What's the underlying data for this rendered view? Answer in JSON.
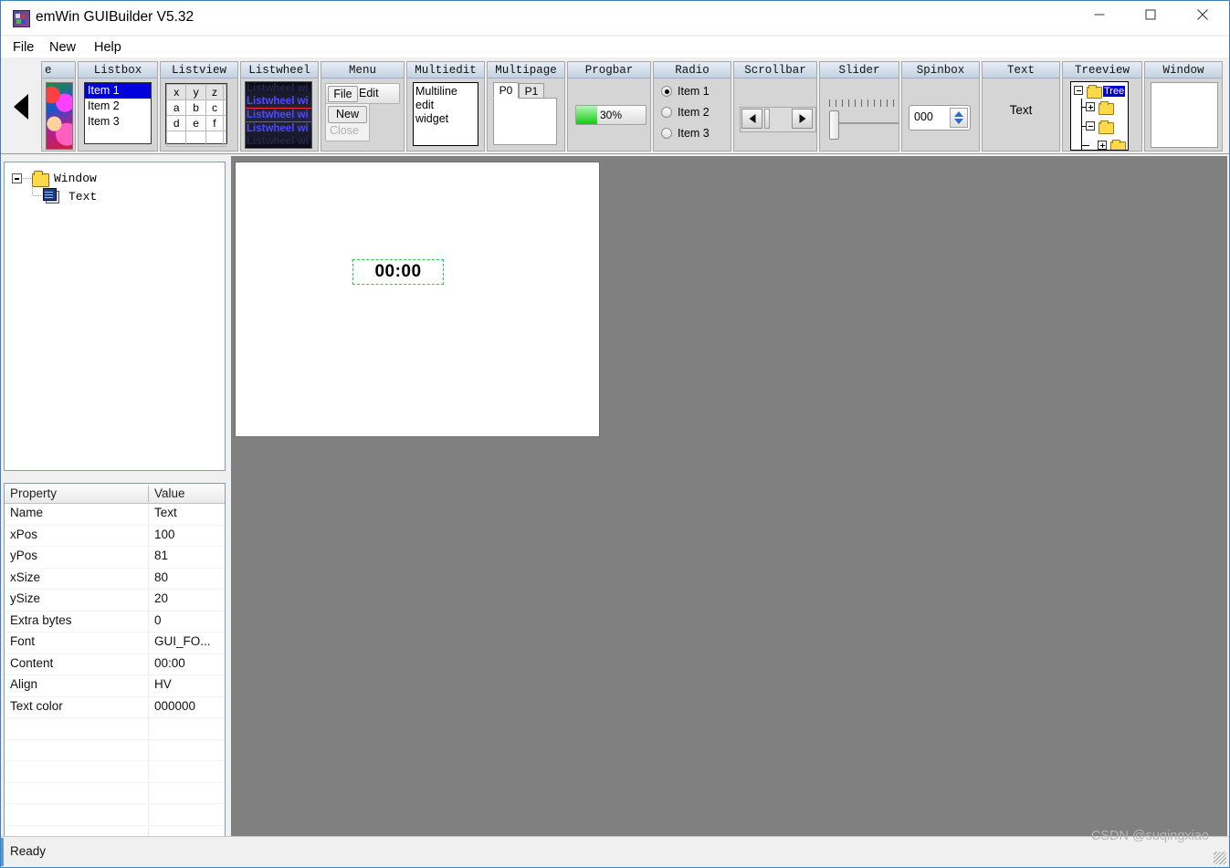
{
  "window": {
    "title": "emWin GUIBuilder V5.32",
    "controls": {
      "minimize": "minimize-button",
      "maximize": "maximize-button",
      "close": "close-button"
    }
  },
  "menubar": {
    "items": [
      "File",
      "New",
      "Help"
    ]
  },
  "toolbar": {
    "scroll_left": "◀",
    "panels": [
      {
        "title": "e",
        "type": "image"
      },
      {
        "title": "Listbox",
        "type": "listbox",
        "items": [
          "Item 1",
          "Item 2",
          "Item 3"
        ],
        "selected_index": 0
      },
      {
        "title": "Listview",
        "type": "listview",
        "header": [
          "x",
          "y",
          "z"
        ],
        "rows": [
          [
            "a",
            "b",
            "c"
          ],
          [
            "d",
            "e",
            "f"
          ]
        ]
      },
      {
        "title": "Listwheel",
        "type": "listwheel",
        "item_text": "Listwheel wi"
      },
      {
        "title": "Menu",
        "type": "menu",
        "bar": [
          "File",
          "Edit"
        ],
        "dropdown": [
          "New",
          "Close"
        ],
        "disabled": [
          "Close"
        ]
      },
      {
        "title": "Multiedit",
        "type": "multiedit",
        "lines": [
          "Multiline",
          "edit",
          "widget"
        ]
      },
      {
        "title": "Multipage",
        "type": "multipage",
        "tabs": [
          "P0",
          "P1"
        ],
        "active_index": 0
      },
      {
        "title": "Progbar",
        "type": "progbar",
        "value": 30,
        "value_label": "30%"
      },
      {
        "title": "Radio",
        "type": "radio",
        "items": [
          "Item 1",
          "Item 2",
          "Item 3"
        ],
        "selected_index": 0
      },
      {
        "title": "Scrollbar",
        "type": "scrollbar"
      },
      {
        "title": "Slider",
        "type": "slider"
      },
      {
        "title": "Spinbox",
        "type": "spinbox",
        "value": "000"
      },
      {
        "title": "Text",
        "type": "text",
        "content": "Text"
      },
      {
        "title": "Treeview",
        "type": "treeview",
        "selected_label": "Tree"
      },
      {
        "title": "Window",
        "type": "window"
      }
    ]
  },
  "object_tree": {
    "root": {
      "label": "Window",
      "expanded": true
    },
    "child": {
      "label": "Text"
    }
  },
  "properties": {
    "headers": {
      "name": "Property",
      "value": "Value"
    },
    "rows": [
      {
        "name": "Name",
        "value": "Text"
      },
      {
        "name": "xPos",
        "value": "100"
      },
      {
        "name": "yPos",
        "value": "81"
      },
      {
        "name": "xSize",
        "value": "80"
      },
      {
        "name": "ySize",
        "value": "20"
      },
      {
        "name": "Extra bytes",
        "value": "0"
      },
      {
        "name": "Font",
        "value": "GUI_FO..."
      },
      {
        "name": "Content",
        "value": "00:00"
      },
      {
        "name": "Align",
        "value": "HV"
      },
      {
        "name": "Text color",
        "value": "000000"
      }
    ]
  },
  "canvas": {
    "selected_widget": {
      "text": "00:00",
      "selection_color": "#22cc55"
    },
    "background_color": "#808080",
    "form_color": "#ffffff"
  },
  "statusbar": {
    "text": "Ready"
  },
  "watermark": {
    "text": "CSDN @suqingxiao"
  }
}
